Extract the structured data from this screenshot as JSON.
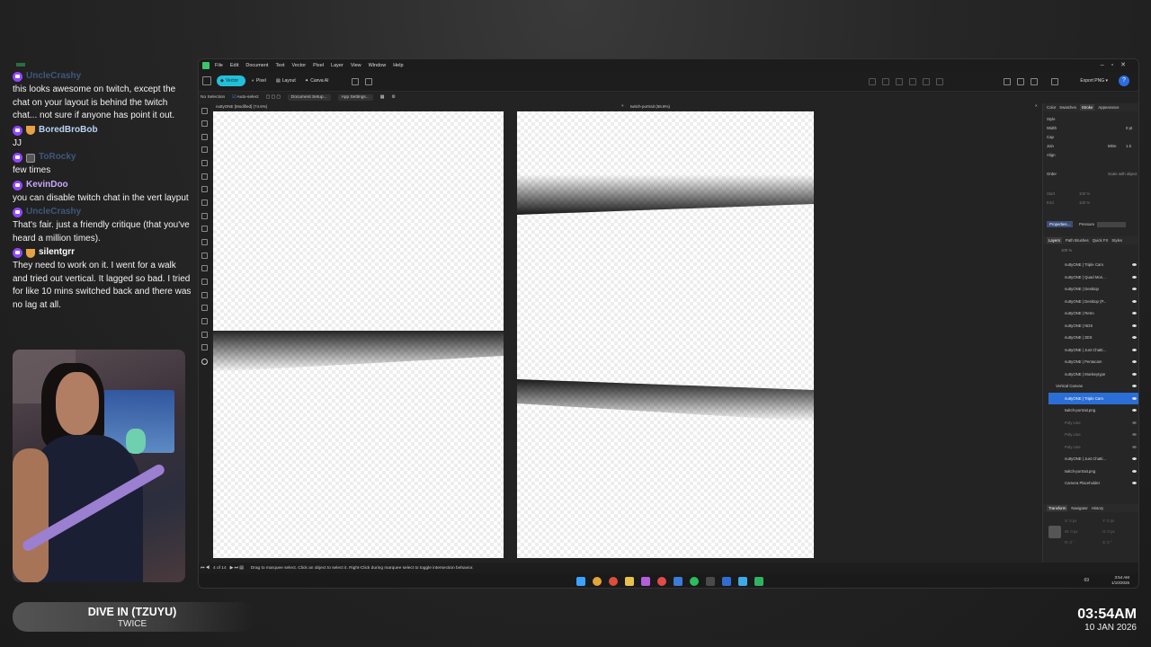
{
  "chat": {
    "messages": [
      {
        "user": "UncleCrashy",
        "color": "#5b8cd6",
        "badges": [
          "sub"
        ],
        "faded_name": true,
        "text": "this looks awesome on twitch, except the chat on your layout is behind the twitch chat... not sure if anyone has point it out."
      },
      {
        "user": "BoredBroBob",
        "color": "#b9d3f5",
        "badges": [
          "sub",
          "cup"
        ],
        "faded_name": false,
        "text": "JJ"
      },
      {
        "user": "ToRocky",
        "color": "#5b8cd6",
        "badges": [
          "sub",
          "dark"
        ],
        "faded_name": true,
        "text": "few times"
      },
      {
        "user": "KevinDoo",
        "color": "#c8a9ff",
        "badges": [
          "sub"
        ],
        "faded_name": false,
        "text": "you can disable twitch chat in the vert layput"
      },
      {
        "user": "UncleCrashy",
        "color": "#5b8cd6",
        "badges": [
          "sub"
        ],
        "faded_name": true,
        "text": "That's fair. just a friendly critique (that you've heard a million times)."
      },
      {
        "user": "silentgrr",
        "color": "#ffffff",
        "badges": [
          "sub",
          "cup"
        ],
        "faded_name": false,
        "text": "They need to work on it. I went for a walk and tried out vertical. It lagged so bad. I tried for like 10 mins switched back and there was no lag at all."
      }
    ]
  },
  "now_playing": {
    "title": "DIVE IN (TZUYU)",
    "artist": "TWICE"
  },
  "clock": {
    "time": "03:54AM",
    "date": "10 JAN 2026"
  },
  "app": {
    "menu": [
      "File",
      "Edit",
      "Document",
      "Text",
      "Vector",
      "Pixel",
      "Layer",
      "View",
      "Window",
      "Help"
    ],
    "personas": [
      "Vector",
      "Pixel",
      "Layout",
      "Canva AI"
    ],
    "export_label": "Export PNG",
    "context": {
      "selection": "No Selection",
      "auto_select": "Auto-select",
      "doc_setup": "Document Setup...",
      "app_settings": "App Settings..."
    },
    "tabs": [
      "nuttyONE [Modified] (74.6%)",
      "twitch-portrait (56.8%)"
    ],
    "status": {
      "pages": "4 of 14",
      "hint": "Drag to marquee select. Click an object to select it. Right-Click during marquee select to toggle intersection behavior."
    },
    "tray": {
      "time": "3:54 AM",
      "date": "1/10/2026",
      "temp": "69"
    }
  },
  "panel": {
    "top_tabs": [
      "Color",
      "Swatches",
      "Stroke",
      "Appearance"
    ],
    "stroke": {
      "style": "Style",
      "width": "Width",
      "width_val": "0 pt",
      "cap": "Cap",
      "join": "Join",
      "mitre": "Mitre",
      "mitre_val": "1.5",
      "align": "Align",
      "order": "Order",
      "scale": "Scale with object",
      "start": "Start",
      "end": "End",
      "start_val": "100 %",
      "end_val": "100 %"
    },
    "properties_btn": "Properties...",
    "pressure": "Pressure",
    "layer_tabs": [
      "Layers",
      "Path Brushes",
      "Quick FX",
      "Styles"
    ],
    "opacity": "100 %",
    "layers": [
      {
        "name": "nuttyONE | Triple Cam",
        "state": "normal"
      },
      {
        "name": "nuttyONE | Quad Mon...",
        "state": "normal"
      },
      {
        "name": "nuttyONE | Desktop",
        "state": "normal"
      },
      {
        "name": "nuttyONE | Desktop (P...",
        "state": "normal"
      },
      {
        "name": "nuttyONE | Retro",
        "state": "normal"
      },
      {
        "name": "nuttyONE | NDS",
        "state": "normal"
      },
      {
        "name": "nuttyONE | 3DS",
        "state": "normal"
      },
      {
        "name": "nuttyONE | Just Chatti...",
        "state": "normal"
      },
      {
        "name": "nuttyONE | Pentacam",
        "state": "normal"
      },
      {
        "name": "nuttyONE | Monkeytype",
        "state": "normal"
      },
      {
        "name": "Vertical Canvas",
        "state": "group"
      },
      {
        "name": "nuttyONE | Triple Cam",
        "state": "selected"
      },
      {
        "name": "twitch-portrait.png",
        "state": "normal"
      },
      {
        "name": "Poly Line",
        "state": "dim"
      },
      {
        "name": "Poly Line",
        "state": "dim"
      },
      {
        "name": "Poly Line",
        "state": "dim"
      },
      {
        "name": "nuttyONE | Just Chatti...",
        "state": "normal"
      },
      {
        "name": "twitch-portrait.png",
        "state": "normal"
      },
      {
        "name": "Camera Placeholder",
        "state": "normal"
      }
    ],
    "bottom_tabs": [
      "Transform",
      "Navigator",
      "History"
    ],
    "transform": {
      "x": "X: 0 px",
      "y": "Y: 0 px",
      "w": "W: 0 px",
      "h": "H: 0 px",
      "r": "R: 0 °",
      "s": "S: 0 °"
    }
  },
  "colors": {
    "accent": "#22c0d8",
    "selection": "#2a6ed6",
    "twitch": "#9147ff"
  }
}
